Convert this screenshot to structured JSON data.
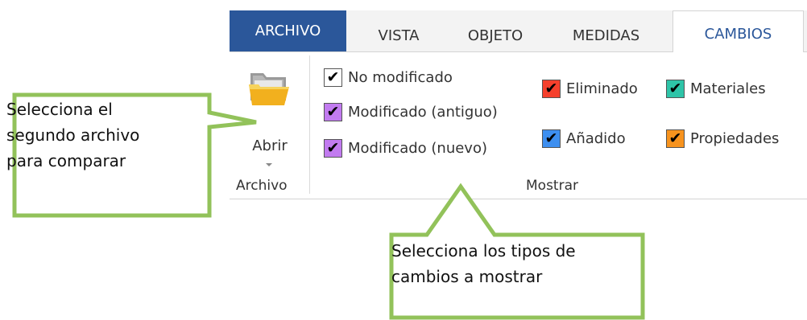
{
  "tabs": {
    "archivo": "ARCHIVO",
    "vista": "VISTA",
    "objeto": "OBJETO",
    "medidas": "MEDIDAS",
    "cambios": "CAMBIOS"
  },
  "archivo_group": {
    "open_label": "Abrir",
    "group_label": "Archivo",
    "icon": "folder-open-icon"
  },
  "mostrar_group": {
    "group_label": "Mostrar",
    "checkboxes": [
      {
        "label": "No modificado",
        "color": "#ffffff",
        "checked": true
      },
      {
        "label": "Modificado (antiguo)",
        "color": "#c27bf0",
        "checked": true
      },
      {
        "label": "Modificado (nuevo)",
        "color": "#c27bf0",
        "checked": true
      },
      {
        "label": "Eliminado",
        "color": "#f5402c",
        "checked": true
      },
      {
        "label": "Añadido",
        "color": "#3d8ff0",
        "checked": true
      },
      {
        "label": "Materiales",
        "color": "#2ec4a8",
        "checked": true
      },
      {
        "label": "Propiedades",
        "color": "#f7931e",
        "checked": true
      }
    ]
  },
  "callouts": {
    "archivo_line1": "Selecciona el",
    "archivo_line2": "segundo archivo",
    "archivo_line3": "para comparar",
    "mostrar_line1": "Selecciona los tipos de",
    "mostrar_line2": "cambios a mostrar"
  },
  "colors": {
    "accent": "#2b579a",
    "callout_border": "#92c25a"
  }
}
